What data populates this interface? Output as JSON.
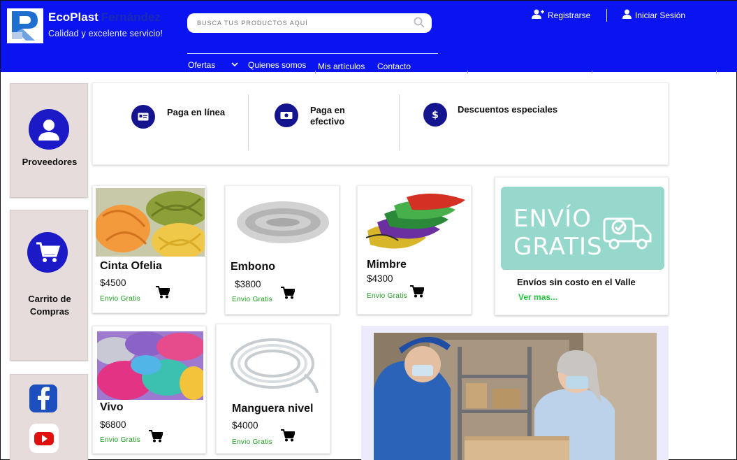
{
  "header": {
    "brand_primary": "EcoPlast",
    "brand_secondary": "Fernández",
    "tagline": "Calidad y excelente servicio!",
    "search_placeholder": "BUSCA TUS PRODUCTOS AQUÍ",
    "register_label": "Registrarse",
    "login_label": "Iniciar Sesión",
    "nav": [
      "Ofertas",
      "Quienes somos",
      "Mis artículos",
      "Contacto"
    ]
  },
  "sidebar": {
    "providers_label": "Proveedores",
    "cart_label": "Carrito de Compras"
  },
  "features": [
    {
      "label": "Paga en línea",
      "icon": "id-card-icon"
    },
    {
      "label": "Paga en efectivo",
      "icon": "cash-icon"
    },
    {
      "label": "Descuentos especiales",
      "icon": "dollar-icon"
    }
  ],
  "products": [
    {
      "name": "Cinta Ofelia",
      "price": "$4500",
      "shipping": "Envio Gratis"
    },
    {
      "name": "Embono",
      "price": "$3800",
      "shipping": "Envio Gratis"
    },
    {
      "name": "Mimbre",
      "price": "$4300",
      "shipping": "Envio Gratis"
    },
    {
      "name": "Vivo",
      "price": "$6800",
      "shipping": "Envio Gratis"
    },
    {
      "name": "Manguera nivel",
      "price": "$4000",
      "shipping": "Envio Gratis"
    }
  ],
  "promo": {
    "image_line1": "ENVÍO",
    "image_line2": "GRATIS",
    "title": "Envíos sin costo en el Valle",
    "link": "Ver mas..."
  },
  "colors": {
    "header_bg": "#0a14f0",
    "accent_circle": "#1c1ac7",
    "ship_green": "#1c9d1c"
  }
}
